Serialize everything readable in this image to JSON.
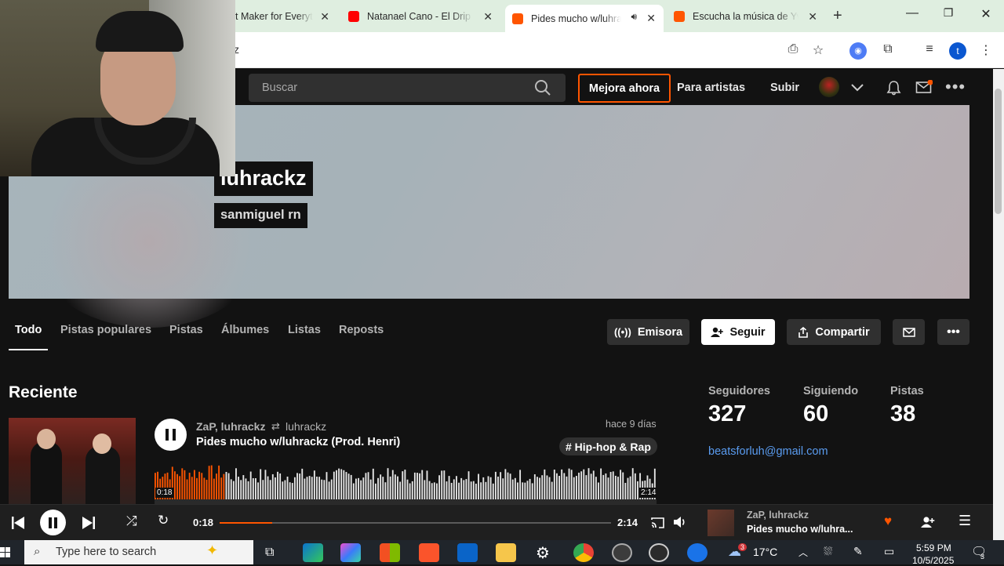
{
  "browser": {
    "tabs": [
      {
        "label": "t Maker for Everyt",
        "favicon": "generic"
      },
      {
        "label": "Natanael Cano - El Drip (",
        "favicon": "youtube"
      },
      {
        "label": "Pides mucho w/luhra",
        "favicon": "soundcloud",
        "active": true
      },
      {
        "label": "Escucha la música de Yvr",
        "favicon": "soundcloud"
      }
    ],
    "address": "z",
    "profile_initial": "t"
  },
  "header": {
    "search_placeholder": "Buscar",
    "upgrade": "Mejora ahora",
    "for_artists": "Para artistas",
    "upload": "Subir"
  },
  "profile": {
    "name": "luhrackz",
    "location": "sanmiguel rn"
  },
  "profile_tabs": [
    "Todo",
    "Pistas populares",
    "Pistas",
    "Álbumes",
    "Listas",
    "Reposts"
  ],
  "actions": {
    "station": "Emisora",
    "follow": "Seguir",
    "share": "Compartir"
  },
  "recent": {
    "title": "Reciente",
    "track": {
      "artists": "ZaP, luhrackz",
      "reposter": "luhrackz",
      "title": "Pides mucho w/luhrackz (Prod. Henri)",
      "date": "hace 9 días",
      "tag": "# Hip-hop & Rap",
      "time_current": "0:18",
      "time_total": "2:14",
      "progress": 0.14
    }
  },
  "stats": {
    "followers_label": "Seguidores",
    "followers": "327",
    "following_label": "Siguiendo",
    "following": "60",
    "tracks_label": "Pistas",
    "tracks": "38",
    "email": "beatsforluh@gmail.com"
  },
  "player": {
    "time_current": "0:18",
    "time_total": "2:14",
    "progress": 0.135,
    "artist": "ZaP, luhrackz",
    "title": "Pides mucho w/luhra..."
  },
  "taskbar": {
    "search_placeholder": "Type here to search",
    "temperature": "17°C",
    "weather_badge": "3",
    "time": "5:59 PM",
    "date": "10/5/2025",
    "notifications": "3"
  },
  "colors": {
    "accent": "#ff5500",
    "link": "#5a9cf0",
    "background": "#121212"
  }
}
